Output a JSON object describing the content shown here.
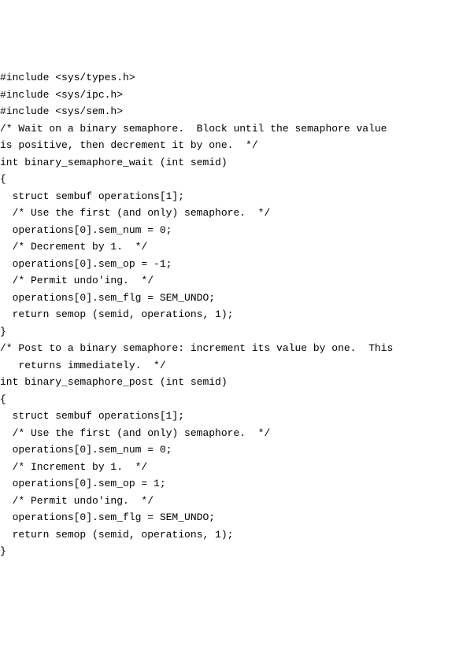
{
  "code_lines": [
    "#include <sys/types.h>",
    "#include <sys/ipc.h>",
    "#include <sys/sem.h>",
    "/* Wait on a binary semaphore.  Block until the semaphore value",
    "is positive, then decrement it by one.  */",
    "int binary_semaphore_wait (int semid)",
    "{",
    "  struct sembuf operations[1];",
    "  /* Use the first (and only) semaphore.  */",
    "  operations[0].sem_num = 0;",
    "  /* Decrement by 1.  */",
    "  operations[0].sem_op = -1;",
    "  /* Permit undo'ing.  */",
    "  operations[0].sem_flg = SEM_UNDO;",
    "  return semop (semid, operations, 1);",
    "}",
    "/* Post to a binary semaphore: increment its value by one.  This",
    "   returns immediately.  */",
    "int binary_semaphore_post (int semid)",
    "{",
    "  struct sembuf operations[1];",
    "  /* Use the first (and only) semaphore.  */",
    "  operations[0].sem_num = 0;",
    "  /* Increment by 1.  */",
    "  operations[0].sem_op = 1;",
    "  /* Permit undo'ing.  */",
    "  operations[0].sem_flg = SEM_UNDO;",
    "  return semop (semid, operations, 1);",
    "}"
  ]
}
